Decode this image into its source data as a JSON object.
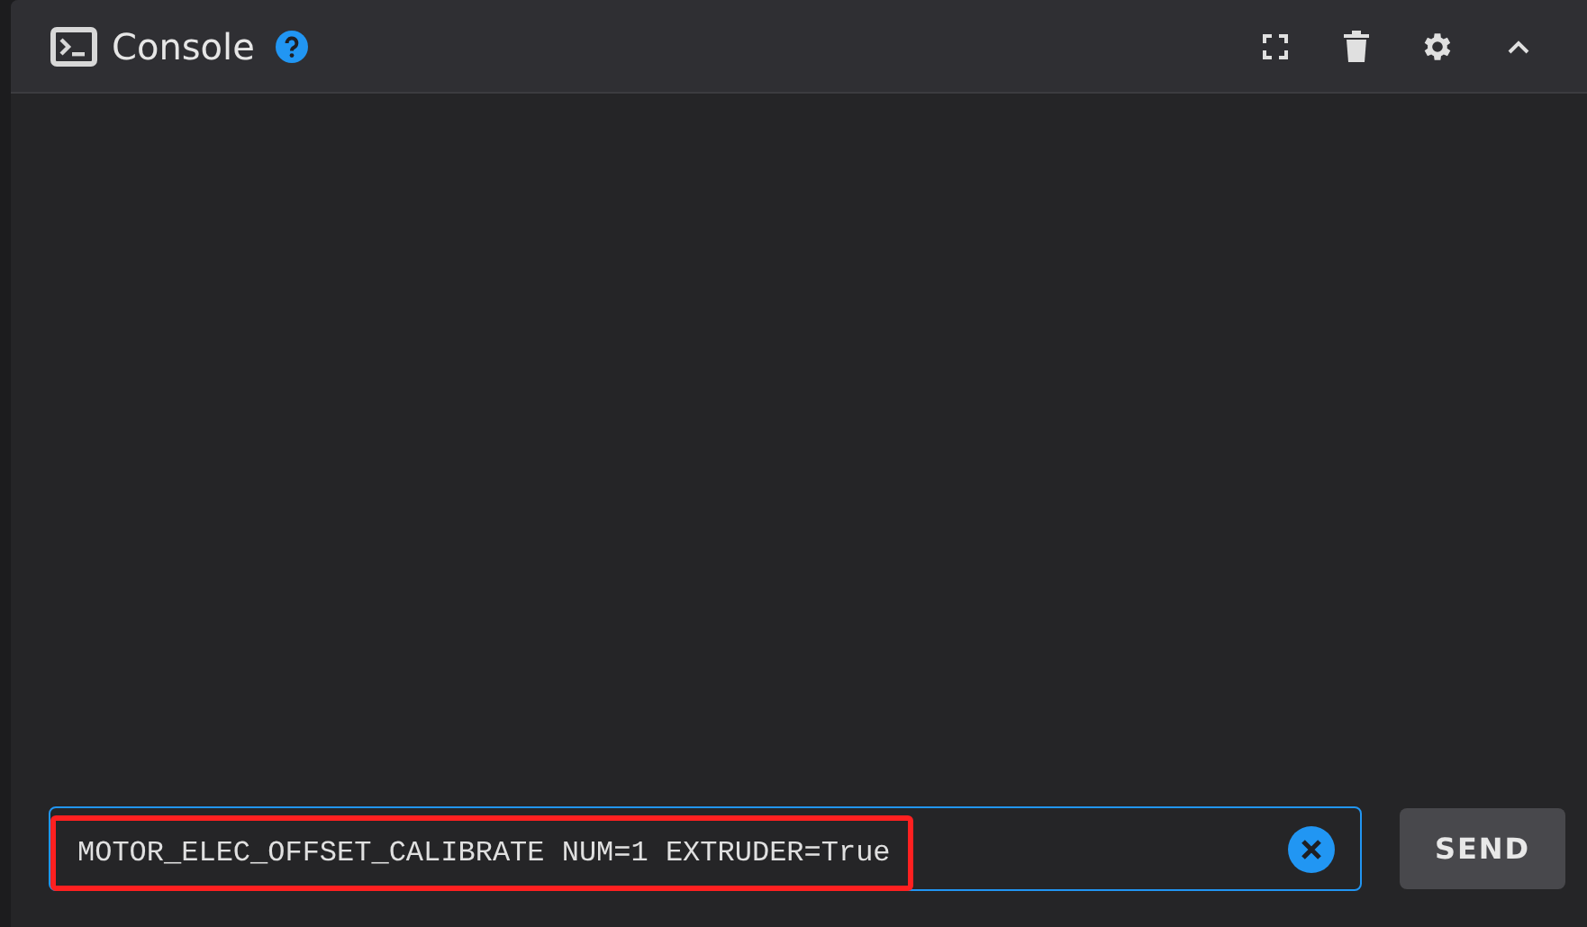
{
  "panel": {
    "title": "Console"
  },
  "command": {
    "value": "MOTOR_ELEC_OFFSET_CALIBRATE NUM=1 EXTRUDER=True",
    "highlighted": true
  },
  "send_button": {
    "label": "SEND"
  }
}
